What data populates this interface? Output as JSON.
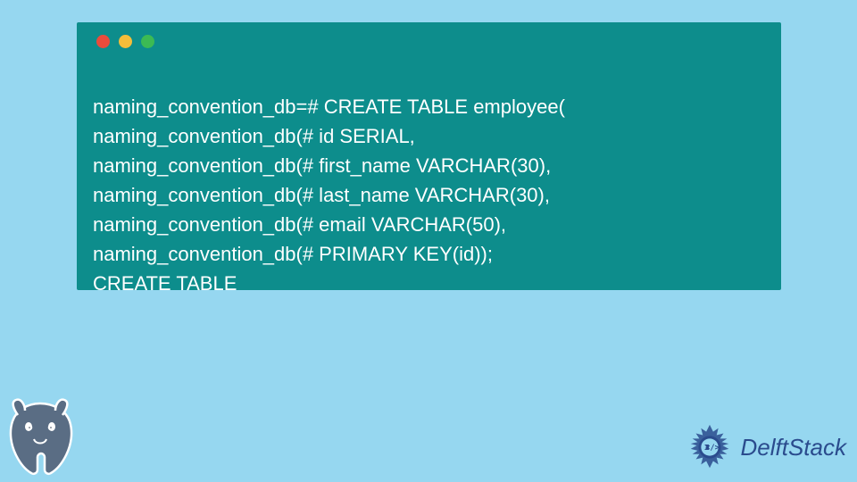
{
  "terminal": {
    "lines": [
      "naming_convention_db=# CREATE TABLE employee(",
      "naming_convention_db(# id SERIAL,",
      "naming_convention_db(# first_name VARCHAR(30),",
      "naming_convention_db(# last_name VARCHAR(30),",
      "naming_convention_db(# email VARCHAR(50),",
      "naming_convention_db(# PRIMARY KEY(id));",
      "CREATE TABLE"
    ]
  },
  "colors": {
    "background": "#96d7f0",
    "terminal_bg": "#0d8d8c",
    "dot_red": "#e94b3c",
    "dot_yellow": "#f4bd3a",
    "dot_green": "#3cba54"
  },
  "branding": {
    "name": "DelftStack"
  }
}
